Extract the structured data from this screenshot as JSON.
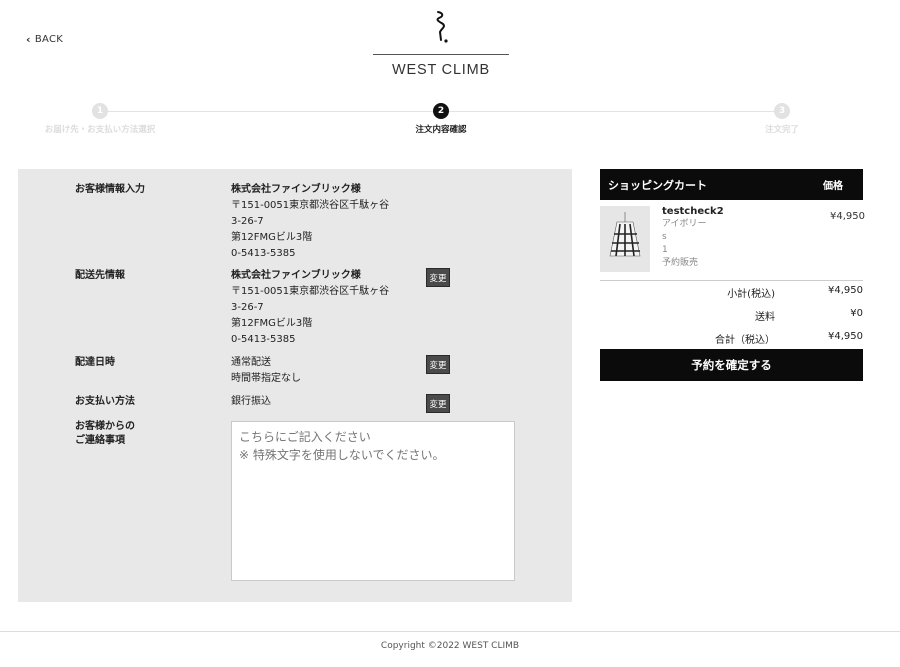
{
  "header": {
    "back_label": "BACK",
    "brand": "WEST CLIMB"
  },
  "steps": [
    {
      "num": "1",
      "label": "お届け先・お支払い方法選択",
      "active": false
    },
    {
      "num": "2",
      "label": "注文内容確認",
      "active": true
    },
    {
      "num": "3",
      "label": "注文完了",
      "active": false
    }
  ],
  "customer": {
    "label": "お客様情報入力",
    "company": "株式会社ファインブリック様",
    "address1": "〒151-0051東京都渋谷区千駄ヶ谷",
    "address2": "3-26-7",
    "address3": "第12FMGビル3階",
    "phone": "0-5413-5385"
  },
  "shipping": {
    "label": "配送先情報",
    "company": "株式会社ファインブリック様",
    "address1": "〒151-0051東京都渋谷区千駄ヶ谷",
    "address2": "3-26-7",
    "address3": "第12FMGビル3階",
    "phone": "0-5413-5385",
    "change_label": "変更"
  },
  "delivery": {
    "label": "配達日時",
    "method": "通常配送",
    "time": "時間帯指定なし",
    "change_label": "変更"
  },
  "payment": {
    "label": "お支払い方法",
    "method": "銀行振込",
    "change_label": "変更"
  },
  "message": {
    "label_line1": "お客様からの",
    "label_line2": "ご連絡事項",
    "placeholder": "こちらにご記入ください\n※ 特殊文字を使用しないでください。"
  },
  "cart": {
    "title": "ショッピングカート",
    "price_header": "価格",
    "item": {
      "name": "testcheck2",
      "color": "アイボリー",
      "size": "s",
      "qty": "1",
      "status": "予約販売",
      "price": "¥4,950"
    },
    "subtotal_label": "小計(税込)",
    "subtotal": "¥4,950",
    "shipping_label": "送料",
    "shipping": "¥0",
    "total_label": "合計（税込）",
    "total": "¥4,950",
    "confirm_label": "予約を確定する"
  },
  "footer": {
    "copyright": "Copyright ©2022 WEST CLIMB"
  }
}
